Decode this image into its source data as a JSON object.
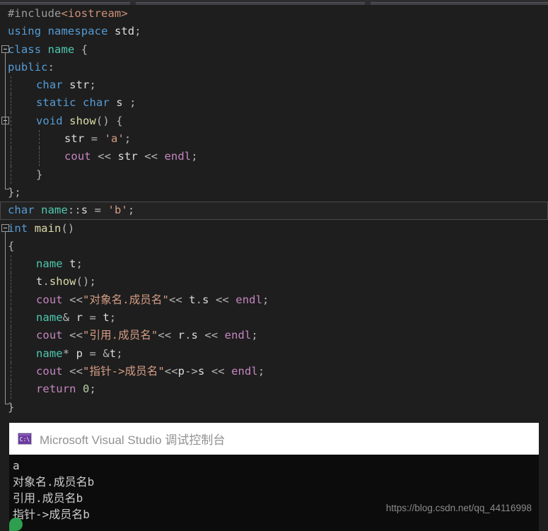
{
  "window": {
    "app": "Visual Studio Code Editor",
    "theme_background": "#1e1e1e"
  },
  "editor": {
    "language": "cpp",
    "current_line_index": 11,
    "lines": [
      {
        "indent": 0,
        "tokens": [
          {
            "t": "#include",
            "c": "pp"
          },
          {
            "t": "<iostream>",
            "c": "inc"
          }
        ]
      },
      {
        "indent": 0,
        "tokens": [
          {
            "t": "using",
            "c": "kw"
          },
          {
            "t": " ",
            "c": "op"
          },
          {
            "t": "namespace",
            "c": "kw"
          },
          {
            "t": " ",
            "c": "op"
          },
          {
            "t": "std",
            "c": "id"
          },
          {
            "t": ";",
            "c": "op"
          }
        ]
      },
      {
        "indent": 0,
        "tokens": [
          {
            "t": "class",
            "c": "kw"
          },
          {
            "t": " ",
            "c": "op"
          },
          {
            "t": "name",
            "c": "type"
          },
          {
            "t": " ",
            "c": "op"
          },
          {
            "t": "{",
            "c": "op"
          }
        ]
      },
      {
        "indent": 0,
        "tokens": [
          {
            "t": "public",
            "c": "kw"
          },
          {
            "t": ":",
            "c": "op"
          }
        ]
      },
      {
        "indent": 1,
        "tokens": [
          {
            "t": "char",
            "c": "kw"
          },
          {
            "t": " ",
            "c": "op"
          },
          {
            "t": "str",
            "c": "id"
          },
          {
            "t": ";",
            "c": "op"
          }
        ]
      },
      {
        "indent": 1,
        "tokens": [
          {
            "t": "static",
            "c": "kw"
          },
          {
            "t": " ",
            "c": "op"
          },
          {
            "t": "char",
            "c": "kw"
          },
          {
            "t": " ",
            "c": "op"
          },
          {
            "t": "s",
            "c": "id"
          },
          {
            "t": " ;",
            "c": "op"
          }
        ]
      },
      {
        "indent": 1,
        "tokens": [
          {
            "t": "void",
            "c": "kw"
          },
          {
            "t": " ",
            "c": "op"
          },
          {
            "t": "show",
            "c": "fn"
          },
          {
            "t": "() {",
            "c": "op"
          }
        ]
      },
      {
        "indent": 2,
        "tokens": [
          {
            "t": "str",
            "c": "id"
          },
          {
            "t": " = ",
            "c": "op"
          },
          {
            "t": "'a'",
            "c": "str"
          },
          {
            "t": ";",
            "c": "op"
          }
        ]
      },
      {
        "indent": 2,
        "tokens": [
          {
            "t": "cout",
            "c": "ctl"
          },
          {
            "t": " << ",
            "c": "op"
          },
          {
            "t": "str",
            "c": "id"
          },
          {
            "t": " << ",
            "c": "op"
          },
          {
            "t": "endl",
            "c": "ctl"
          },
          {
            "t": ";",
            "c": "op"
          }
        ]
      },
      {
        "indent": 1,
        "tokens": [
          {
            "t": "}",
            "c": "op"
          }
        ]
      },
      {
        "indent": 0,
        "tokens": [
          {
            "t": "};",
            "c": "op"
          }
        ]
      },
      {
        "indent": 0,
        "tokens": [
          {
            "t": "char",
            "c": "kw"
          },
          {
            "t": " ",
            "c": "op"
          },
          {
            "t": "name",
            "c": "type"
          },
          {
            "t": "::",
            "c": "op"
          },
          {
            "t": "s",
            "c": "id"
          },
          {
            "t": " = ",
            "c": "op"
          },
          {
            "t": "'b'",
            "c": "str"
          },
          {
            "t": ";",
            "c": "op"
          }
        ]
      },
      {
        "indent": 0,
        "tokens": [
          {
            "t": "int",
            "c": "kw"
          },
          {
            "t": " ",
            "c": "op"
          },
          {
            "t": "main",
            "c": "fn"
          },
          {
            "t": "()",
            "c": "op"
          }
        ]
      },
      {
        "indent": 0,
        "tokens": [
          {
            "t": "{",
            "c": "op"
          }
        ]
      },
      {
        "indent": 1,
        "tokens": [
          {
            "t": "name",
            "c": "type"
          },
          {
            "t": " ",
            "c": "op"
          },
          {
            "t": "t",
            "c": "id"
          },
          {
            "t": ";",
            "c": "op"
          }
        ]
      },
      {
        "indent": 1,
        "tokens": [
          {
            "t": "t",
            "c": "id"
          },
          {
            "t": ".",
            "c": "op"
          },
          {
            "t": "show",
            "c": "fn"
          },
          {
            "t": "();",
            "c": "op"
          }
        ]
      },
      {
        "indent": 1,
        "tokens": [
          {
            "t": "cout",
            "c": "ctl"
          },
          {
            "t": " <<",
            "c": "op"
          },
          {
            "t": "\"对象名.成员名\"",
            "c": "str"
          },
          {
            "t": "<< ",
            "c": "op"
          },
          {
            "t": "t",
            "c": "id"
          },
          {
            "t": ".",
            "c": "op"
          },
          {
            "t": "s",
            "c": "id"
          },
          {
            "t": " << ",
            "c": "op"
          },
          {
            "t": "endl",
            "c": "ctl"
          },
          {
            "t": ";",
            "c": "op"
          }
        ]
      },
      {
        "indent": 1,
        "tokens": [
          {
            "t": "name",
            "c": "type"
          },
          {
            "t": "& ",
            "c": "op"
          },
          {
            "t": "r",
            "c": "id"
          },
          {
            "t": " = ",
            "c": "op"
          },
          {
            "t": "t",
            "c": "id"
          },
          {
            "t": ";",
            "c": "op"
          }
        ]
      },
      {
        "indent": 1,
        "tokens": [
          {
            "t": "cout",
            "c": "ctl"
          },
          {
            "t": " <<",
            "c": "op"
          },
          {
            "t": "\"引用.成员名\"",
            "c": "str"
          },
          {
            "t": "<< ",
            "c": "op"
          },
          {
            "t": "r",
            "c": "id"
          },
          {
            "t": ".",
            "c": "op"
          },
          {
            "t": "s",
            "c": "id"
          },
          {
            "t": " << ",
            "c": "op"
          },
          {
            "t": "endl",
            "c": "ctl"
          },
          {
            "t": ";",
            "c": "op"
          }
        ]
      },
      {
        "indent": 1,
        "tokens": [
          {
            "t": "name",
            "c": "type"
          },
          {
            "t": "* ",
            "c": "op"
          },
          {
            "t": "p",
            "c": "id"
          },
          {
            "t": " = &",
            "c": "op"
          },
          {
            "t": "t",
            "c": "id"
          },
          {
            "t": ";",
            "c": "op"
          }
        ]
      },
      {
        "indent": 1,
        "tokens": [
          {
            "t": "cout",
            "c": "ctl"
          },
          {
            "t": " <<",
            "c": "op"
          },
          {
            "t": "\"指针->成员名\"",
            "c": "str"
          },
          {
            "t": "<<",
            "c": "op"
          },
          {
            "t": "p",
            "c": "id"
          },
          {
            "t": "->",
            "c": "op"
          },
          {
            "t": "s",
            "c": "id"
          },
          {
            "t": " << ",
            "c": "op"
          },
          {
            "t": "endl",
            "c": "ctl"
          },
          {
            "t": ";",
            "c": "op"
          }
        ]
      },
      {
        "indent": 1,
        "tokens": [
          {
            "t": "return",
            "c": "ctl"
          },
          {
            "t": " ",
            "c": "op"
          },
          {
            "t": "0",
            "c": "num"
          },
          {
            "t": ";",
            "c": "op"
          }
        ]
      },
      {
        "indent": 0,
        "tokens": [
          {
            "t": "}",
            "c": "op"
          }
        ]
      }
    ]
  },
  "console": {
    "title": "Microsoft Visual Studio 调试控制台",
    "icon": "console-cmd-icon",
    "icon_glyph": "C:\\",
    "output_lines": [
      "a",
      "对象名.成员名b",
      "引用.成员名b",
      "指针->成员名b"
    ],
    "watermark": "https://blog.csdn.net/qq_44116998",
    "background": "#0c0c0c",
    "titlebar_background": "#ffffff"
  }
}
